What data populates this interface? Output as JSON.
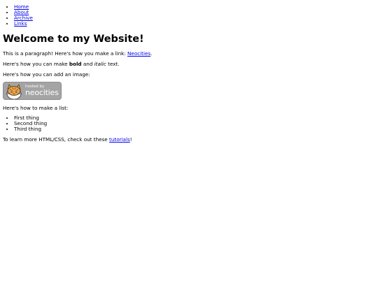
{
  "nav": {
    "items": [
      {
        "label": "Home"
      },
      {
        "label": "About"
      },
      {
        "label": "Archive"
      },
      {
        "label": "Links"
      }
    ]
  },
  "content": {
    "heading": "Welcome to my Website!",
    "para1_text": "This is a paragraph! Here's how you make a link: ",
    "para1_link": "Neocities",
    "para1_end": ".",
    "para2_pre": "Here's how you can make ",
    "para2_bold": "bold",
    "para2_mid": " and ",
    "para2_italic": "italic",
    "para2_end": " text.",
    "para3": "Here's how you can add an image:",
    "badge_small": "hosted by",
    "badge_big": "neocities",
    "para4": "Here's how to make a list:",
    "list_items": [
      {
        "label": "First thing"
      },
      {
        "label": "Second thing"
      },
      {
        "label": "Third thing"
      }
    ],
    "para5_pre": "To learn more HTML/CSS, check out these ",
    "para5_link": "tutorials",
    "para5_end": "!"
  },
  "colors": {
    "link": "#0000ee",
    "badge_bg": "#a4a4a4",
    "badge_cat": "#f3a33a"
  }
}
